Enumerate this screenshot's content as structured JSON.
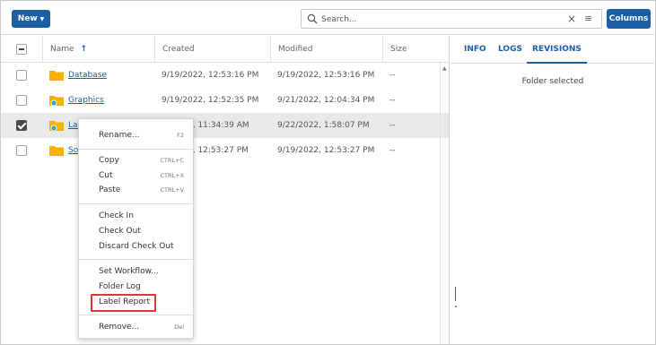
{
  "toolbar": {
    "new_label": "New",
    "search_placeholder": "Search...",
    "columns_label": "Columns"
  },
  "grid": {
    "columns": [
      "Name",
      "Created",
      "Modified",
      "Size"
    ],
    "rows": [
      {
        "name": "Database",
        "created": "9/19/2022, 12:53:16 PM",
        "modified": "9/19/2022, 12:53:16 PM",
        "size": "--",
        "checked": false
      },
      {
        "name": "Graphics",
        "created": "9/19/2022, 12:52:35 PM",
        "modified": "9/21/2022, 12:04:34 PM",
        "size": "--",
        "checked": false
      },
      {
        "name": "Lab",
        "created": "2, 11:34:39 AM",
        "modified": "9/22/2022, 1:58:07 PM",
        "size": "--",
        "checked": true
      },
      {
        "name": "Sol",
        "created": "2, 12:53:27 PM",
        "modified": "9/19/2022, 12:53:27 PM",
        "size": "--",
        "checked": false
      }
    ]
  },
  "panel": {
    "tabs": [
      "INFO",
      "LOGS",
      "REVISIONS"
    ],
    "active_tab": "REVISIONS",
    "message": "Folder selected"
  },
  "context_menu": {
    "items": [
      {
        "label": "Rename...",
        "shortcut": "F2"
      },
      {
        "label": "Copy",
        "shortcut": "CTRL+C"
      },
      {
        "label": "Cut",
        "shortcut": "CTRL+X"
      },
      {
        "label": "Paste",
        "shortcut": "CTRL+V"
      },
      {
        "label": "Check In",
        "shortcut": ""
      },
      {
        "label": "Check Out",
        "shortcut": ""
      },
      {
        "label": "Discard Check Out",
        "shortcut": ""
      },
      {
        "label": "Set Workflow...",
        "shortcut": ""
      },
      {
        "label": "Folder Log",
        "shortcut": ""
      },
      {
        "label": "Label Report",
        "shortcut": ""
      },
      {
        "label": "Remove...",
        "shortcut": "Del"
      }
    ]
  },
  "colors": {
    "accent": "#1c5fa6",
    "folder": "#f5b301",
    "shared_badge": "#2aa9d8",
    "highlight": "#d9363e"
  },
  "icons": [
    "chevron-down-icon",
    "search-icon",
    "close-icon",
    "filter-icon",
    "sort-arrow-up-icon",
    "folder-icon",
    "shared-folder-icon",
    "scroll-up-icon"
  ]
}
